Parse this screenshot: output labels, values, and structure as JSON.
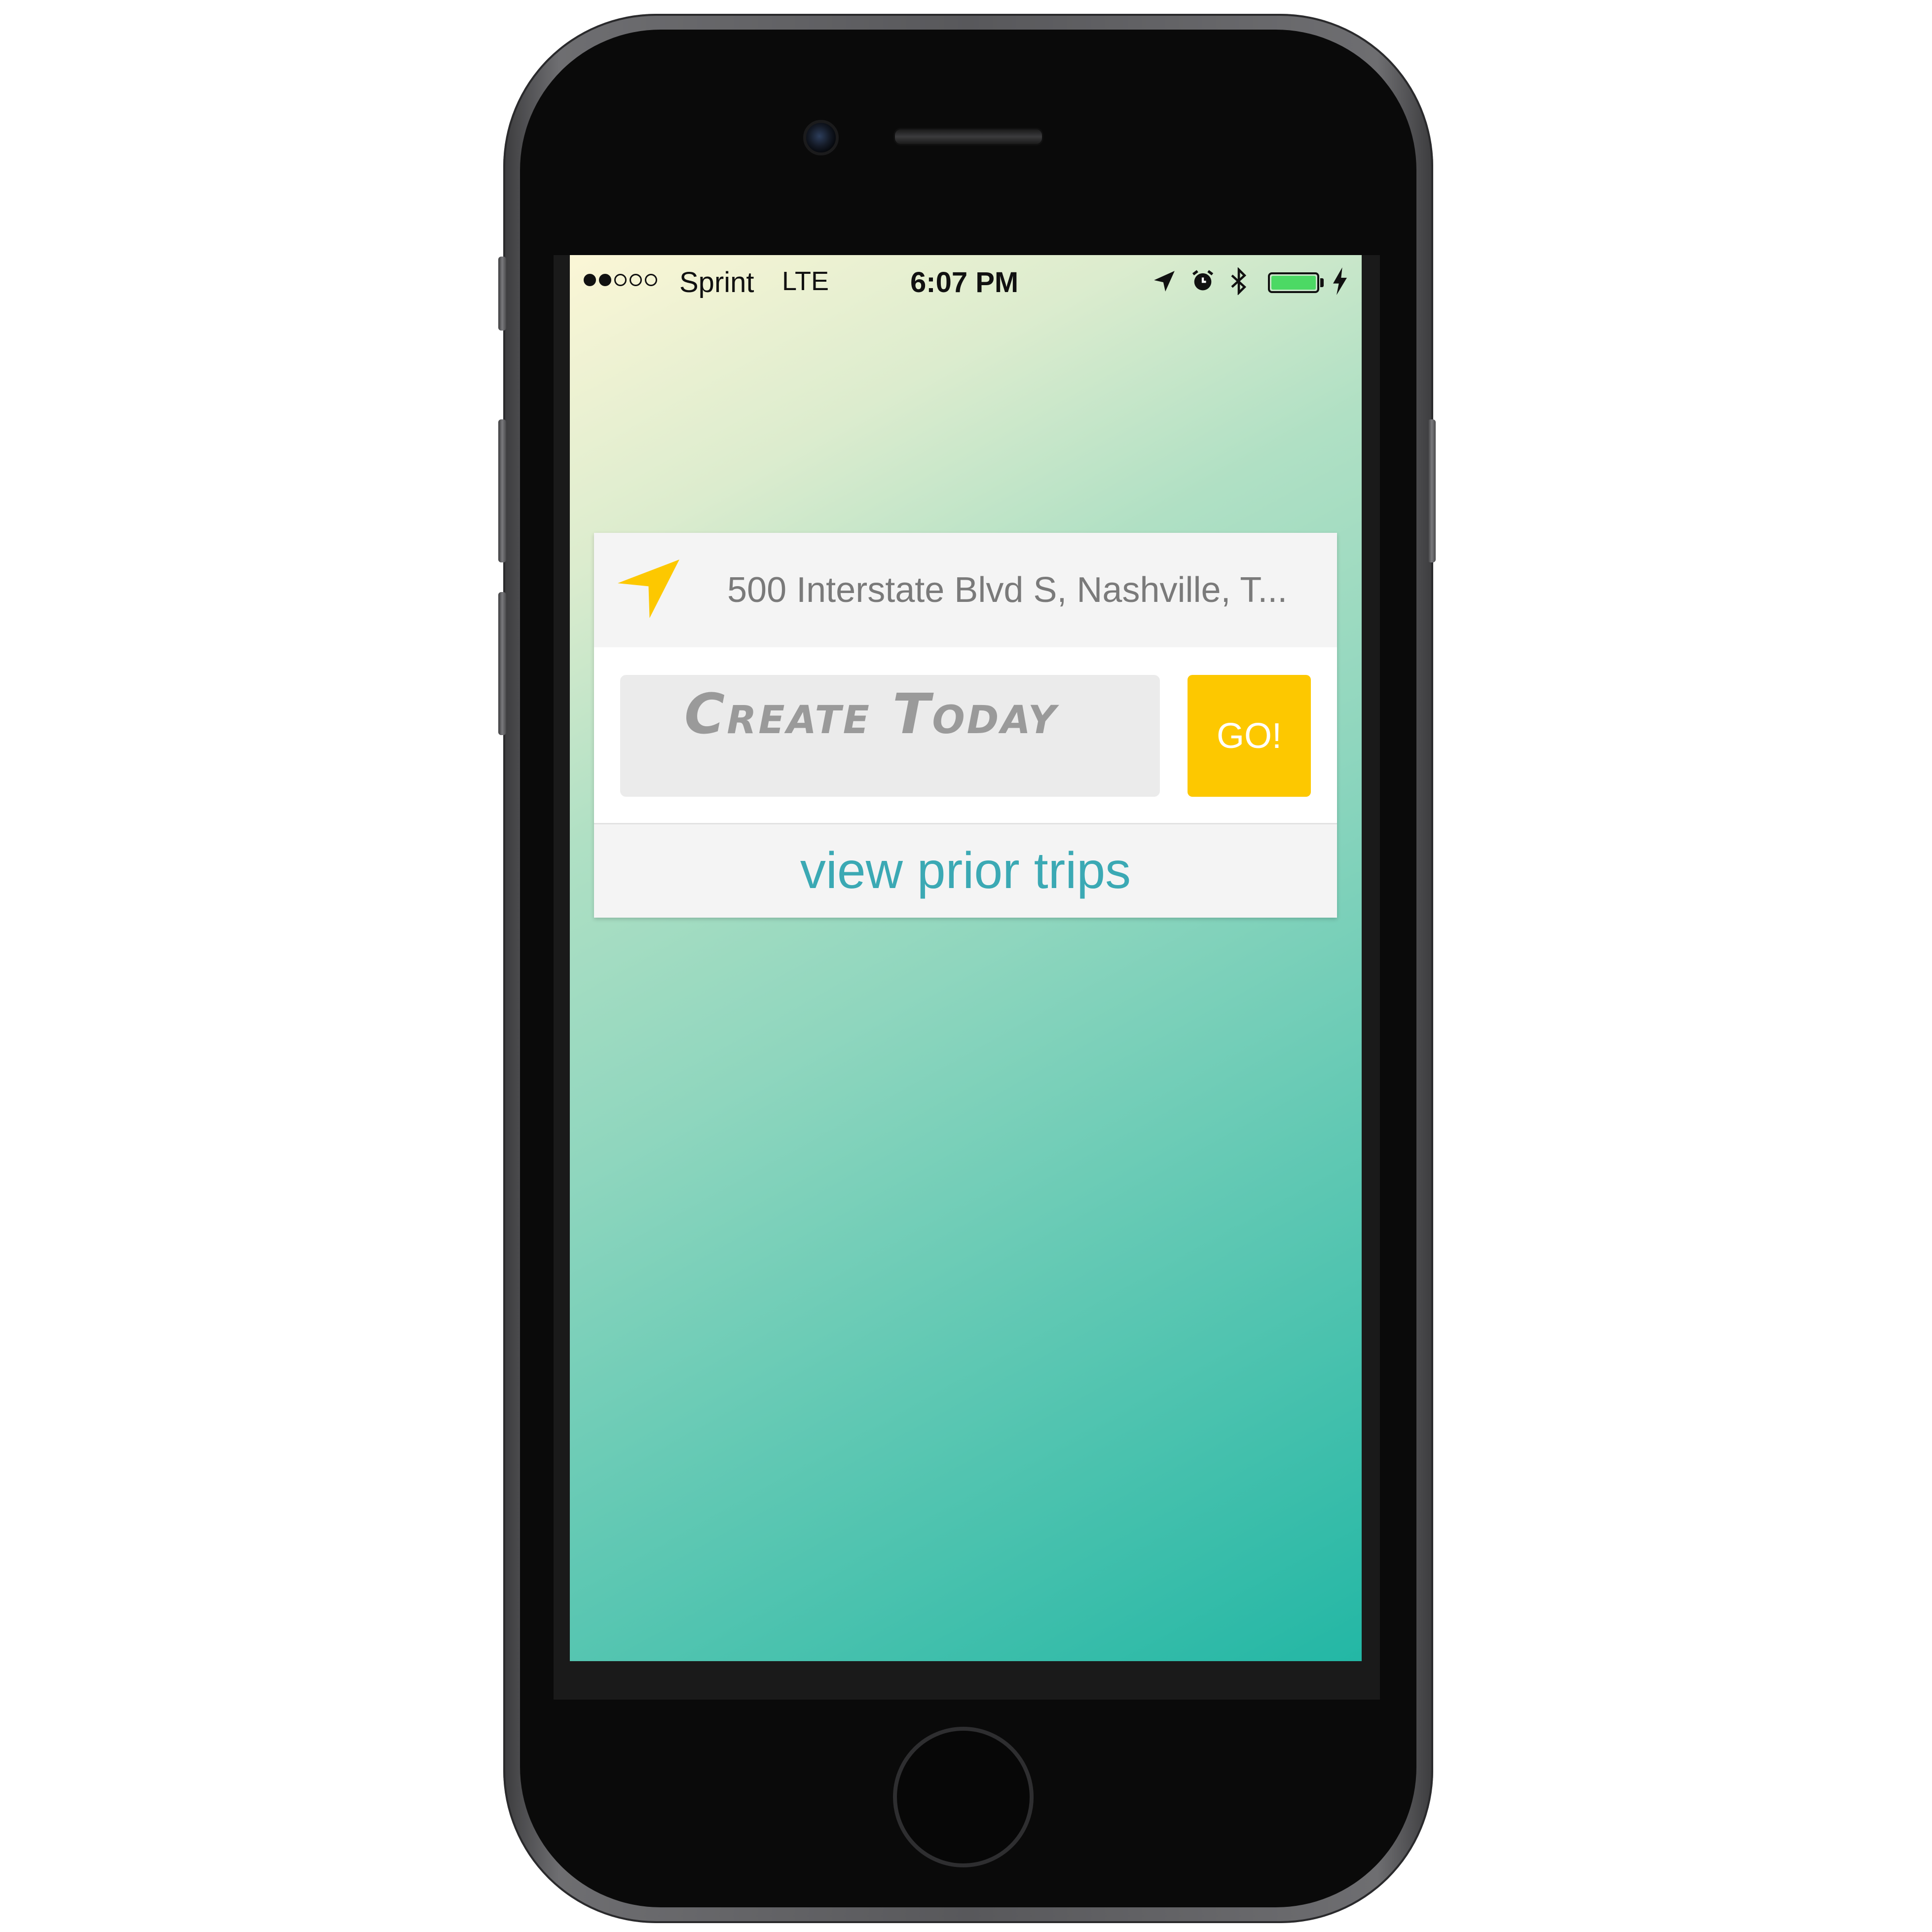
{
  "status_bar": {
    "signal_dots": [
      true,
      true,
      false,
      false,
      false
    ],
    "carrier": "Sprint",
    "network": "LTE",
    "time": "6:07 PM",
    "icons": [
      "location-arrow-icon",
      "alarm-icon",
      "bluetooth-icon",
      "battery-icon",
      "charging-bolt-icon"
    ],
    "battery_level": 1.0
  },
  "location": {
    "icon": "location-arrow-icon",
    "address": "500 Interstate Blvd S, Nashville, T..."
  },
  "trip_input": {
    "placeholder": "Create Today"
  },
  "go_button": {
    "label": "GO!"
  },
  "prior_trips": {
    "label": "view prior trips"
  },
  "colors": {
    "accent_yellow": "#fdc800",
    "link_teal": "#3ba9b4",
    "gradient_start": "#fbf6d6",
    "gradient_end": "#23b7a5",
    "battery_green": "#4cd964"
  }
}
